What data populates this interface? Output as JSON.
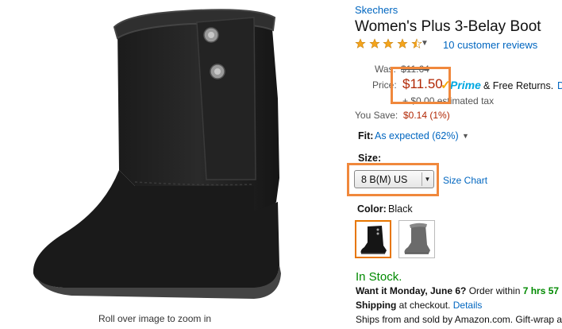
{
  "image": {
    "zoom_hint": "Roll over image to zoom in"
  },
  "product": {
    "brand": "Skechers",
    "title": "Women's Plus 3-Belay Boot",
    "rating": 4.5,
    "reviews_link": "10 customer reviews"
  },
  "pricing": {
    "was_label": "Was:",
    "was_price": "$11.64",
    "price_label": "Price:",
    "price": "$11.50",
    "prime_label": "Prime",
    "free_returns": "& Free Returns.",
    "details_link": "D",
    "tax": "+ $0.00 estimated tax",
    "save_label": "You Save:",
    "save_value": "$0.14 (1%)",
    "highlight_color": "#f0883c"
  },
  "fit": {
    "label": "Fit:",
    "value": "As expected (62%)"
  },
  "size": {
    "label": "Size:",
    "selected": "8 B(M) US",
    "chart_link": "Size Chart"
  },
  "color": {
    "label": "Color:",
    "value": "Black",
    "swatches": [
      "Black",
      "Gray"
    ]
  },
  "availability": {
    "stock": "In Stock.",
    "want_it": "Want it Monday, June 6?",
    "order_within": "Order within",
    "countdown": "7 hrs 57",
    "shipping_bold": "Shipping",
    "shipping_rest": "at checkout.",
    "shipping_details_link": "Details",
    "ships_from": "Ships from and sold by Amazon.com. Gift-wrap a"
  }
}
